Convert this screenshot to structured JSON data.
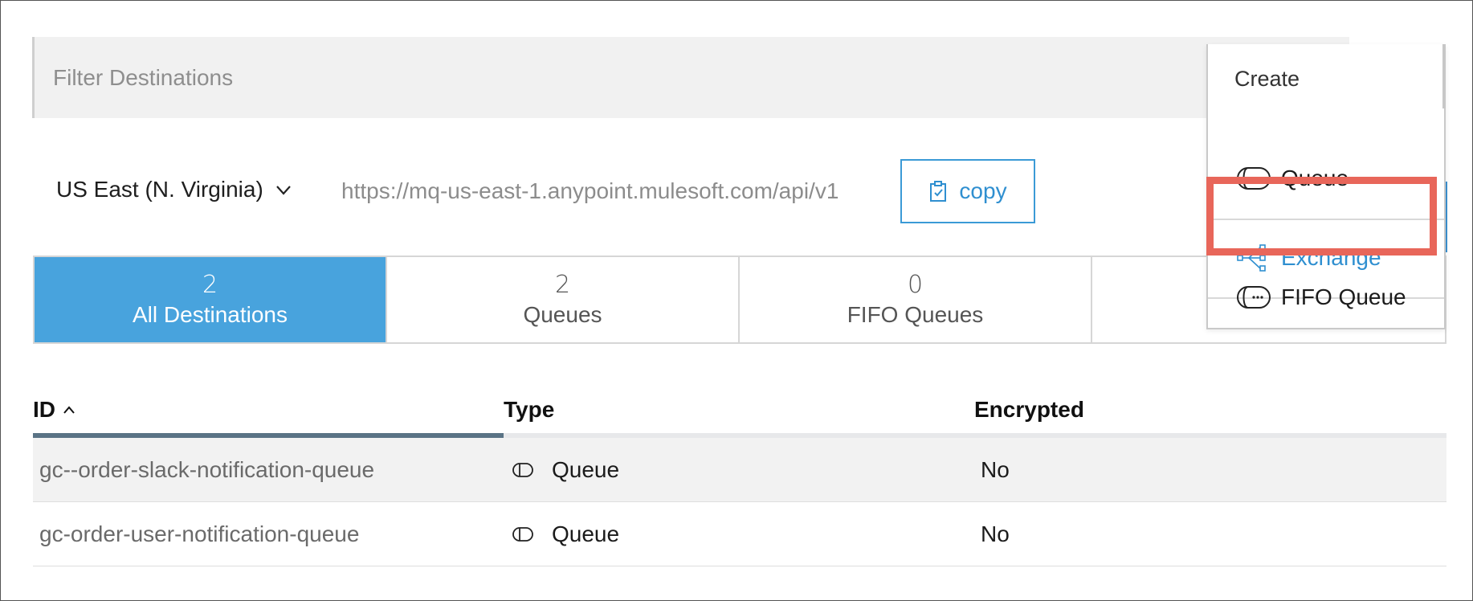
{
  "filter": {
    "placeholder": "Filter Destinations"
  },
  "region": {
    "selected": "US East (N. Virginia)"
  },
  "endpoint": {
    "url": "https://mq-us-east-1.anypoint.mulesoft.com/api/v1",
    "copy_label": "copy"
  },
  "tabs": [
    {
      "count": "2",
      "label": "All Destinations",
      "active": true
    },
    {
      "count": "2",
      "label": "Queues",
      "active": false
    },
    {
      "count": "0",
      "label": "FIFO Queues",
      "active": false
    },
    {
      "count": "",
      "label": "",
      "active": false
    }
  ],
  "table": {
    "headers": {
      "id": "ID",
      "type": "Type",
      "encrypted": "Encrypted"
    },
    "sort_icon": "chevron-up-icon",
    "rows": [
      {
        "id": "gc--order-slack-notification-queue",
        "type": "Queue",
        "encrypted": "No"
      },
      {
        "id": "gc-order-user-notification-queue",
        "type": "Queue",
        "encrypted": "No"
      }
    ]
  },
  "create_menu": {
    "title": "Create",
    "items": [
      {
        "label": "Queue",
        "icon": "queue-icon"
      },
      {
        "label": "Exchange",
        "icon": "exchange-icon"
      },
      {
        "label": "FIFO Queue",
        "icon": "fifo-queue-icon"
      }
    ]
  },
  "colors": {
    "accent": "#48a3dd",
    "link": "#2f8fd0",
    "highlight": "#e8665a"
  }
}
